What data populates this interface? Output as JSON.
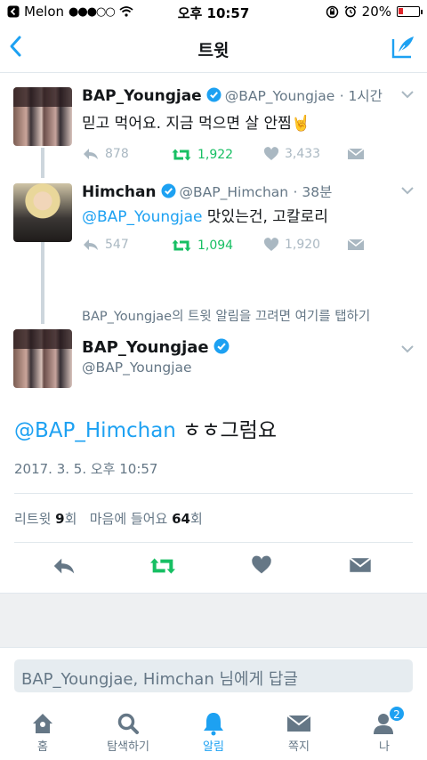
{
  "status_bar": {
    "carrier": "Melon",
    "signal_dots": "●●●○○",
    "time": "오후 10:57",
    "battery": "20%",
    "battery_level": 0.2
  },
  "nav": {
    "title": "트윗"
  },
  "thread": [
    {
      "name": "BAP_Youngjae",
      "handle": "@BAP_Youngjae",
      "time": "· 1시간",
      "text": "믿고 먹어요. 지금 먹으면 살 안찜🤘",
      "replies": "878",
      "retweets": "1,922",
      "likes": "3,433"
    },
    {
      "name": "Himchan",
      "handle": "@BAP_Himchan",
      "time": "· 38분",
      "mention": "@BAP_Youngjae",
      "text": " 맛있는건, 고칼로리",
      "replies": "547",
      "retweets": "1,094",
      "likes": "1,920"
    }
  ],
  "notice": "BAP_Youngjae의 트윗 알림을 끄려면 여기를 탭하기",
  "focus": {
    "name": "BAP_Youngjae",
    "handle": "@BAP_Youngjae",
    "mention": "@BAP_Himchan",
    "text": " ㅎㅎ그럼요",
    "timestamp": "2017. 3. 5. 오후 10:57",
    "retweet_label": "리트윗 ",
    "retweet_count": "9",
    "retweet_unit": "회",
    "like_label": "마음에 들어요 ",
    "like_count": "64",
    "like_unit": "회"
  },
  "reply_placeholder": "BAP_Youngjae, Himchan 님에게 답글",
  "tabs": [
    {
      "label": "홈",
      "icon": "home-icon"
    },
    {
      "label": "탐색하기",
      "icon": "search-icon"
    },
    {
      "label": "알림",
      "icon": "bell-icon"
    },
    {
      "label": "쪽지",
      "icon": "envelope-icon"
    },
    {
      "label": "나",
      "icon": "person-icon",
      "badge": "2"
    }
  ],
  "colors": {
    "accent": "#1da1f2",
    "retweet": "#17bf63",
    "muted": "#aab8c2"
  }
}
